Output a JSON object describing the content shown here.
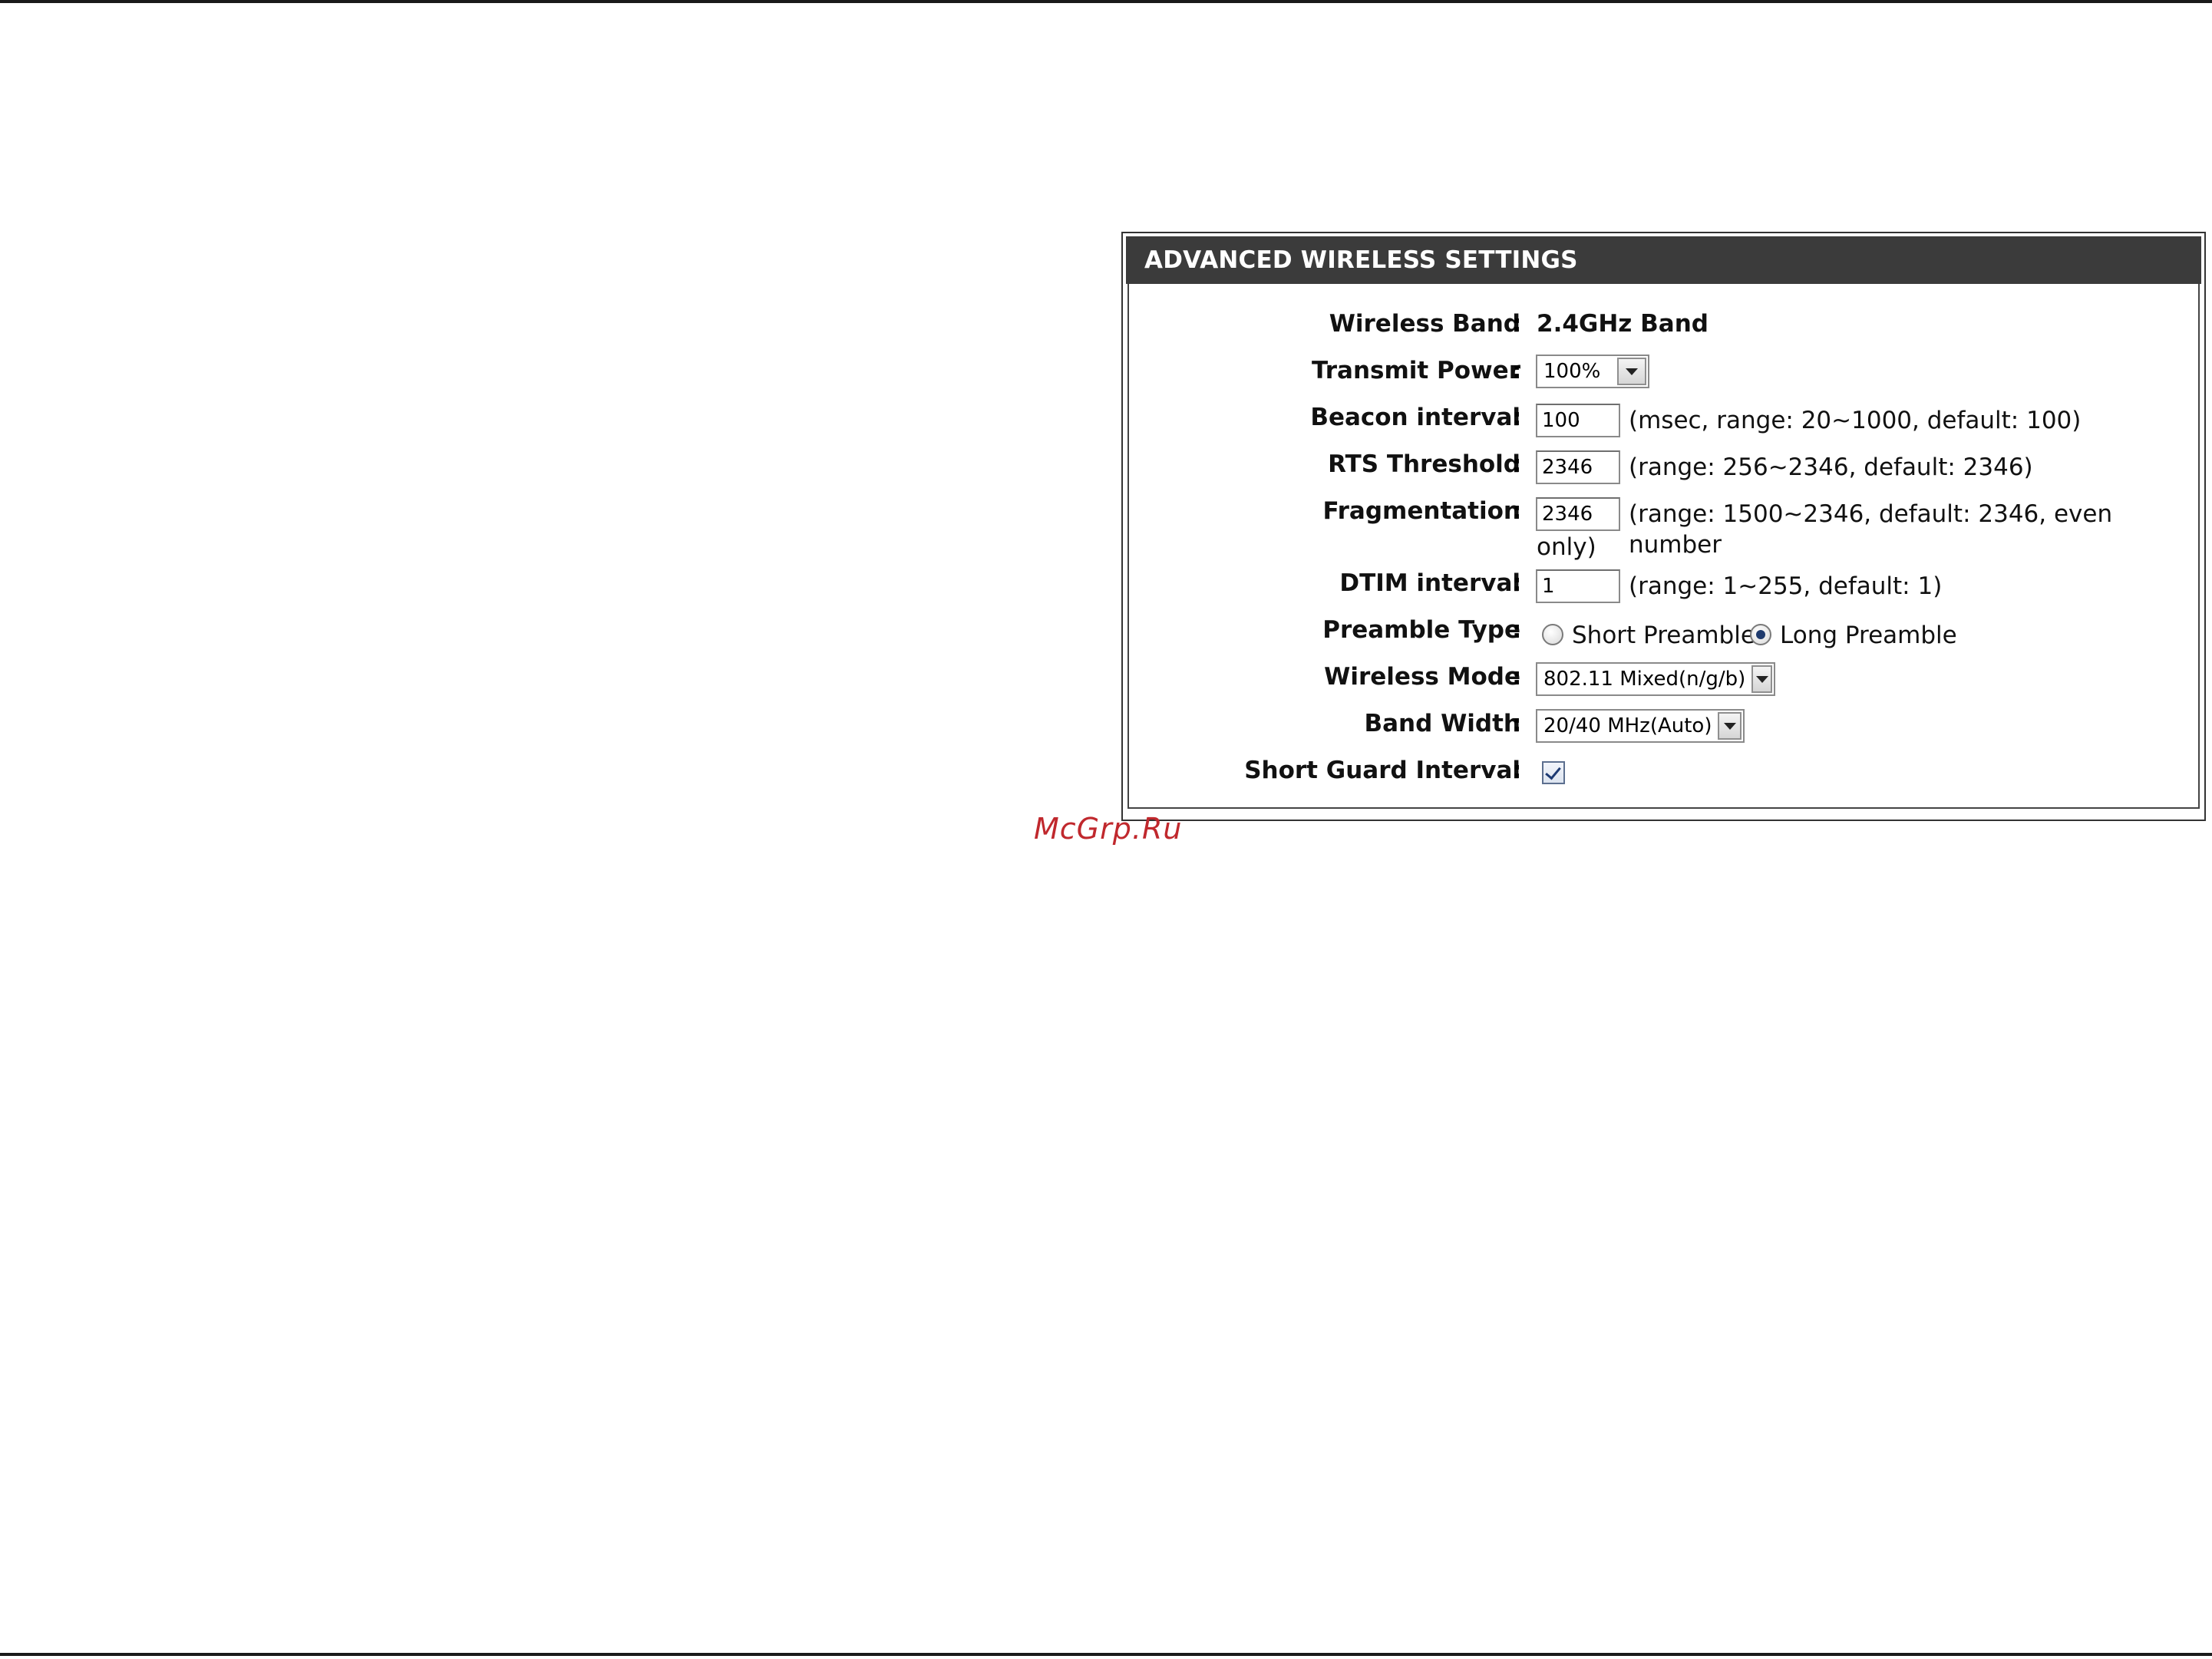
{
  "panel": {
    "title": "ADVANCED WIRELESS SETTINGS"
  },
  "fields": {
    "wireless_band": {
      "label": "Wireless Band",
      "value": "2.4GHz Band"
    },
    "transmit_power": {
      "label": "Transmit Power",
      "selected": "100%"
    },
    "beacon_interval": {
      "label": "Beacon interval",
      "value": "100",
      "hint": "(msec, range: 20~1000, default: 100)"
    },
    "rts_threshold": {
      "label": "RTS Threshold",
      "value": "2346",
      "hint": "(range: 256~2346, default: 2346)"
    },
    "fragmentation": {
      "label": "Fragmentation",
      "value": "2346",
      "hint": "(range: 1500~2346, default: 2346, even number",
      "hint_cont": "only)"
    },
    "dtim_interval": {
      "label": "DTIM interval",
      "value": "1",
      "hint": "(range: 1~255, default: 1)"
    },
    "preamble_type": {
      "label": "Preamble Type",
      "option_short": "Short Preamble",
      "option_long": "Long Preamble",
      "selected": "Long Preamble"
    },
    "wireless_mode": {
      "label": "Wireless Mode",
      "selected": "802.11 Mixed(n/g/b)"
    },
    "band_width": {
      "label": "Band Width",
      "selected": "20/40 MHz(Auto)"
    },
    "short_guard_interval": {
      "label": "Short Guard Interval",
      "checked": true
    }
  },
  "colon": ":",
  "watermark": "McGrp.Ru"
}
